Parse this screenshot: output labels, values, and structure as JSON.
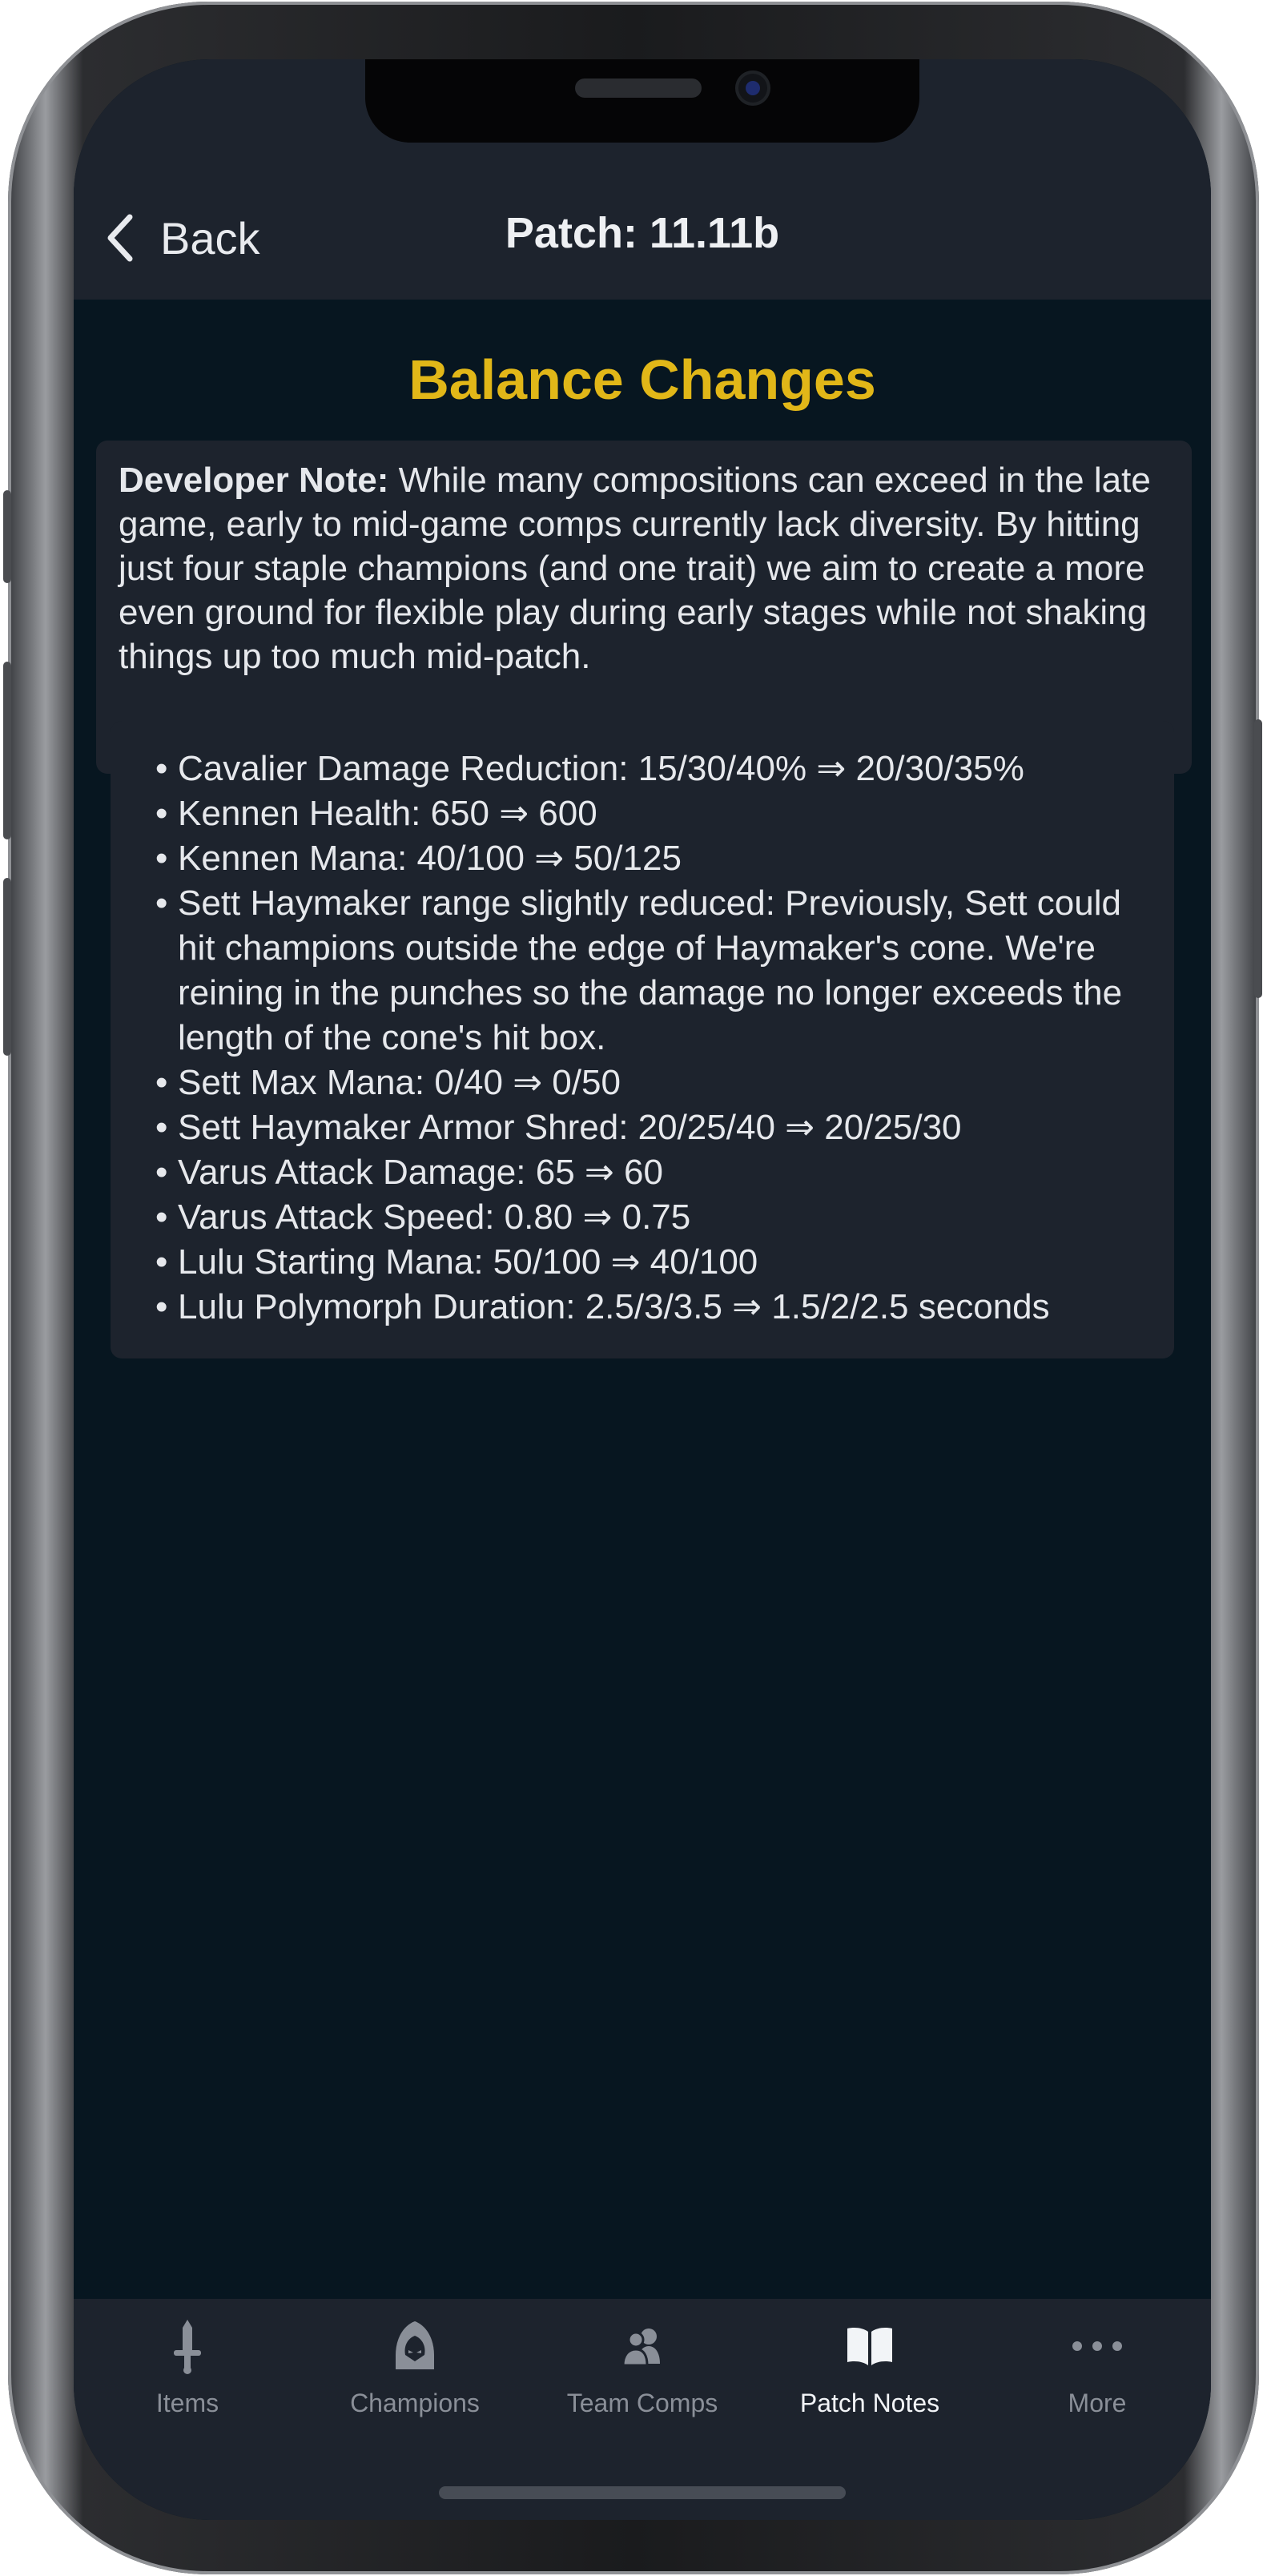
{
  "nav": {
    "back_label": "Back",
    "title": "Patch: 11.11b"
  },
  "section": {
    "title": "Balance Changes"
  },
  "developer_note": {
    "label": "Developer Note:",
    "text": " While many compositions can exceed in the late game, early to mid-game comps currently lack diversity. By hitting just four staple champions (and one trait) we aim to create a more even ground for flexible play during early stages while not shaking things up too much mid-patch."
  },
  "changes": [
    "Cavalier Damage Reduction: 15/30/40% ⇒ 20/30/35%",
    "Kennen Health: 650 ⇒ 600",
    "Kennen Mana: 40/100 ⇒ 50/125",
    "Sett Haymaker range slightly reduced: Previously, Sett could hit champions outside the edge of Haymaker's cone. We're reining in the punches so the damage no longer exceeds the length of the cone's hit box.",
    "Sett Max Mana: 0/40 ⇒ 0/50",
    "Sett Haymaker Armor Shred: 20/25/40 ⇒ 20/25/30",
    "Varus Attack Damage: 65 ⇒ 60",
    "Varus Attack Speed: 0.80 ⇒ 0.75",
    "Lulu Starting Mana: 50/100 ⇒ 40/100",
    "Lulu Polymorph Duration: 2.5/3/3.5 ⇒ 1.5/2/2.5 seconds"
  ],
  "tabs": [
    {
      "label": "Items",
      "icon": "sword-icon",
      "active": false
    },
    {
      "label": "Champions",
      "icon": "hooded-champion-icon",
      "active": false
    },
    {
      "label": "Team Comps",
      "icon": "team-icon",
      "active": false
    },
    {
      "label": "Patch Notes",
      "icon": "open-book-icon",
      "active": true
    },
    {
      "label": "More",
      "icon": "ellipsis-icon",
      "active": false
    }
  ],
  "colors": {
    "background": "#071620",
    "bar": "#1d232d",
    "accent_title": "#e1b718",
    "tab_inactive": "#8a8f98",
    "tab_active": "#f2f4f7"
  }
}
